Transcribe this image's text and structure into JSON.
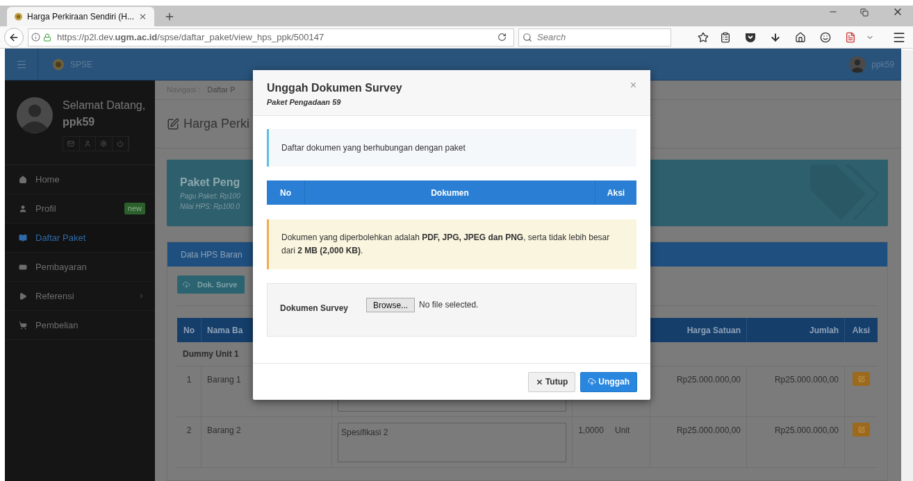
{
  "browser": {
    "tab_title": "Harga Perkiraan Sendiri (H...",
    "url": "https://p2l.dev.**ugm.ac.id**/spse/daftar_paket/view_hps_ppk/500147",
    "search": {
      "placeholder": "Search"
    }
  },
  "app_header": {
    "brand": "SPSE",
    "user": "ppk59"
  },
  "sidebar": {
    "greeting": "Selamat Datang,",
    "username": "ppk59",
    "items": [
      {
        "label": "Home",
        "selected": false
      },
      {
        "label": "Profil",
        "selected": false,
        "badge": "new"
      },
      {
        "label": "Daftar Paket",
        "selected": true
      },
      {
        "label": "Pembayaran",
        "selected": false
      },
      {
        "label": "Referensi",
        "selected": false,
        "expandable": true
      },
      {
        "label": "Pembelian",
        "selected": false
      }
    ]
  },
  "main": {
    "breadcrumb": {
      "label": "Navigasi :",
      "item": "Daftar P"
    },
    "title": "Harga Perki",
    "package": {
      "title": "Paket Peng",
      "pagu": "Pagu Paket: Rp100",
      "hps": "Nilai HPS: Rp100.0"
    },
    "tab": "Data HPS Baran",
    "survey_button": "Dok. Surve",
    "table": {
      "columns": [
        "No",
        "Nama Ba",
        "Harga Satuan",
        "Jumlah",
        "Aksi"
      ],
      "rows": [
        {
          "kind": "group",
          "label": "Dummy Unit 1"
        },
        {
          "kind": "item",
          "no": "1",
          "name": "Barang 1",
          "price": "Rp25.000.000,00",
          "total": "Rp25.000.000,00"
        },
        {
          "kind": "item",
          "no": "2",
          "name": "Barang 2",
          "spec": "Spesifikasi 2",
          "volume": "1,0000",
          "unit": "Unit",
          "price": "Rp25.000.000,00",
          "total": "Rp25.000.000,00"
        }
      ]
    }
  },
  "modal": {
    "title": "Unggah Dokumen Survey",
    "subtitle": "Paket Pengadaan 59",
    "close": "×",
    "info": "Daftar dokumen yang berhubungan dengan paket",
    "table": {
      "columns": [
        "No",
        "Dokumen",
        "Aksi"
      ]
    },
    "warning": "Dokumen yang diperbolehkan adalah **PDF, JPG, JPEG dan PNG**, serta tidak lebih besar dari **2 MB (2,000 KB)**.",
    "file_field": {
      "label": "Dokumen Survey",
      "browse": "Browse...",
      "status": "No file selected."
    },
    "buttons": [
      {
        "kind": "secondary",
        "label": "Tutup"
      },
      {
        "kind": "primary",
        "label": "Unggah"
      }
    ]
  }
}
